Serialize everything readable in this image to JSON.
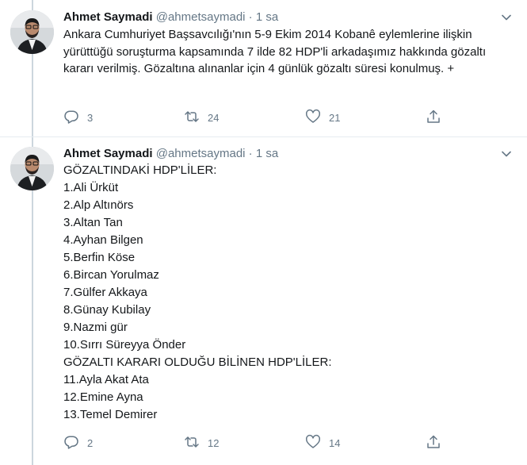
{
  "tweets": [
    {
      "author_name": "Ahmet Saymadi",
      "handle": "@ahmetsaymadi",
      "separator": "·",
      "time": "1 sa",
      "text": "Ankara Cumhuriyet Başsavcılığı'nın 5-9 Ekim 2014 Kobanê eylemlerine ilişkin yürüttüğü soruşturma kapsamında 7 ilde 82 HDP'li arkadaşımız hakkında gözaltı kararı verilmiş. Gözaltına alınanlar için 4 günlük gözaltı süresi konulmuş. +",
      "replies": "3",
      "retweets": "24",
      "likes": "21"
    },
    {
      "author_name": "Ahmet Saymadi",
      "handle": "@ahmetsaymadi",
      "separator": "·",
      "time": "1 sa",
      "lines": [
        "GÖZALTINDAKİ  HDP'LİLER:",
        "1.Ali Ürküt",
        "2.Alp Altınörs",
        "3.Altan Tan",
        "4.Ayhan Bilgen",
        "5.Berfin Köse",
        "6.Bircan Yorulmaz",
        "7.Gülfer Akkaya",
        "8.Günay Kubilay",
        "9.Nazmi gür",
        "10.Sırrı Süreyya Önder",
        "GÖZALTI KARARI OLDUĞU BİLİNEN HDP'LİLER:",
        "11.Ayla Akat Ata",
        "12.Emine Ayna",
        "13.Temel Demirer"
      ],
      "replies": "2",
      "retweets": "12",
      "likes": "14"
    }
  ],
  "icons": {
    "reply": "reply-icon",
    "retweet": "retweet-icon",
    "like": "like-icon",
    "share": "share-icon",
    "caret": "chevron-down-icon"
  },
  "colors": {
    "text": "#14171a",
    "secondary": "#657786",
    "thread_line": "#ccd6dd"
  }
}
